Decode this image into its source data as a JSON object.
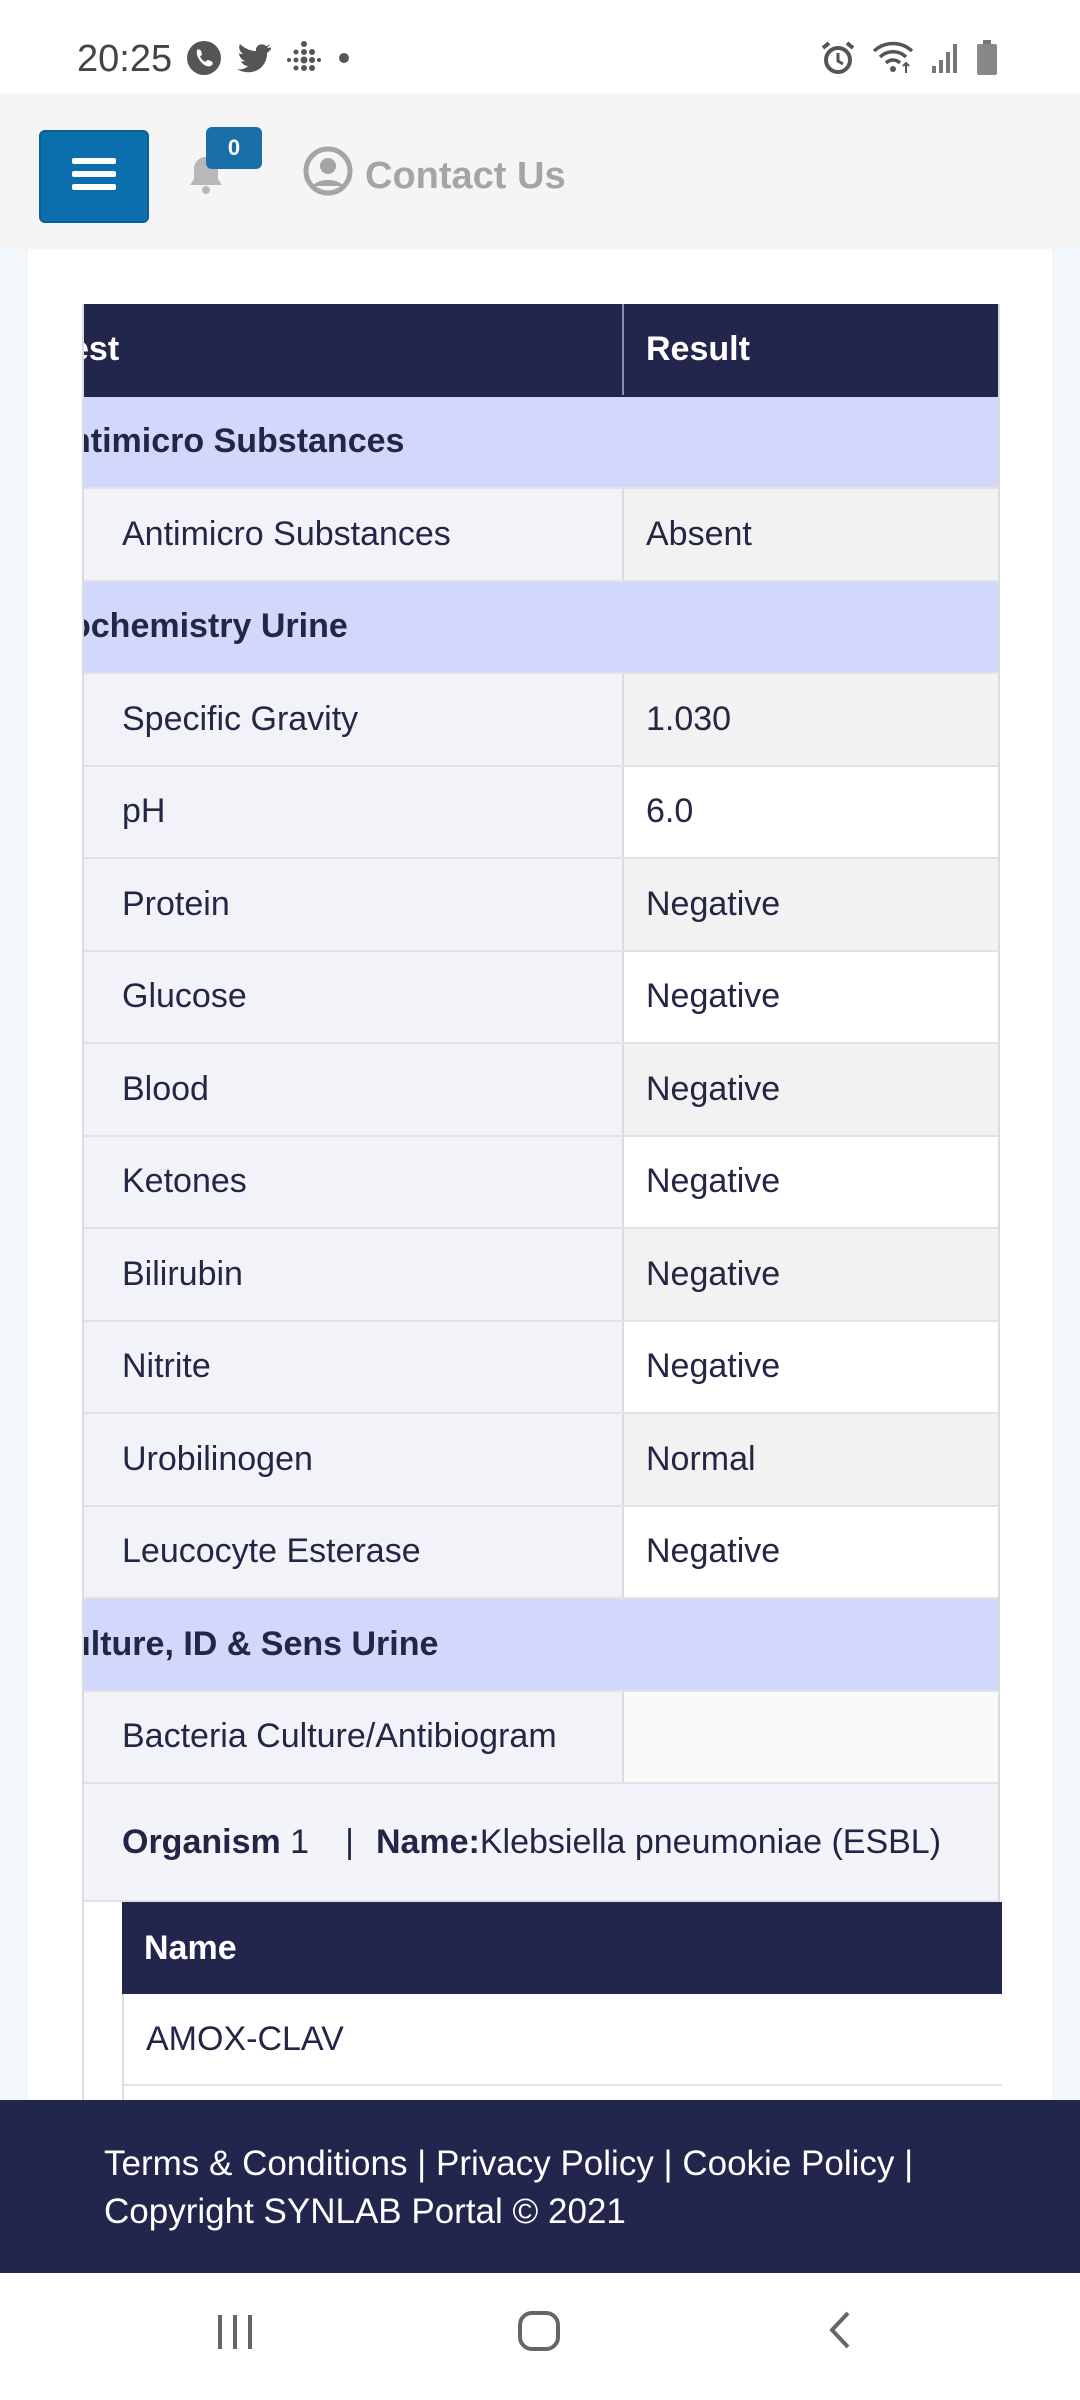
{
  "status_bar": {
    "time": "20:25",
    "left_icons": [
      "phone-icon",
      "twitter-icon",
      "fitbit-icon",
      "dot-icon"
    ],
    "right_icons": [
      "alarm-icon",
      "wifi-icon",
      "signal-icon",
      "battery-icon"
    ]
  },
  "header": {
    "menu_icon": "hamburger-icon",
    "notification_count": "0",
    "contact_label": "Contact Us"
  },
  "table": {
    "headers": {
      "test": "est",
      "result": "Result"
    },
    "sections": {
      "antimicro": "ntimicro Substances",
      "biochemistry": "ochemistry Urine",
      "culture": "ulture, ID & Sens Urine"
    },
    "rows": {
      "antimicro_substances": {
        "test": "Antimicro Substances",
        "result": "Absent"
      },
      "specific_gravity": {
        "test": "Specific Gravity",
        "result": "1.030"
      },
      "ph": {
        "test": "pH",
        "result": "6.0"
      },
      "protein": {
        "test": "Protein",
        "result": "Negative"
      },
      "glucose": {
        "test": "Glucose",
        "result": "Negative"
      },
      "blood": {
        "test": "Blood",
        "result": "Negative"
      },
      "ketones": {
        "test": "Ketones",
        "result": "Negative"
      },
      "bilirubin": {
        "test": "Bilirubin",
        "result": "Negative"
      },
      "nitrite": {
        "test": "Nitrite",
        "result": "Negative"
      },
      "urobilinogen": {
        "test": "Urobilinogen",
        "result": "Normal"
      },
      "leucocyte_esterase": {
        "test": "Leucocyte Esterase",
        "result": "Negative"
      },
      "bacteria_culture": {
        "test": "Bacteria Culture/Antibiogram",
        "result": ""
      }
    },
    "organism": {
      "label": "Organism",
      "number": "1",
      "separator": "|",
      "name_label": "Name:",
      "name_value": "Klebsiella pneumoniae (ESBL)"
    },
    "antibiogram": {
      "header": "Name",
      "rows": [
        "AMOX-CLAV"
      ]
    }
  },
  "footer": {
    "links_line": "Terms & Conditions | Privacy Policy | Cookie Policy |",
    "copyright": "Copyright SYNLAB Portal © 2021"
  },
  "nav_bar": {
    "icons": [
      "recents-icon",
      "home-icon",
      "back-icon"
    ]
  },
  "colors": {
    "header_navy": "#22264c",
    "section_lavender": "#d2d7fc",
    "menu_blue": "#0b6fae"
  }
}
